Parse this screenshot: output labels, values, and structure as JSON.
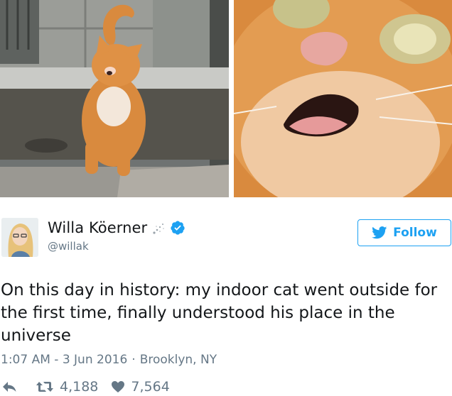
{
  "author": {
    "display_name": "Willa Köerner",
    "handle": "@willak",
    "verified": true
  },
  "follow_button": {
    "label": "Follow",
    "icon": "twitter-bird-icon"
  },
  "tweet": {
    "text": "On this day in history: my indoor cat went outside for the first time, finally understood his place in the universe",
    "time": "1:07 AM - 3 Jun 2016",
    "separator": "·",
    "location": "Brooklyn, NY"
  },
  "stats": {
    "retweets": "4,188",
    "likes": "7,564"
  },
  "icons": {
    "reply": "reply-icon",
    "retweet": "retweet-icon",
    "like": "heart-icon",
    "verified": "verified-badge-icon",
    "sparkle": "sparkle-icon"
  },
  "colors": {
    "accent": "#1da1f2",
    "text": "#14171a",
    "muted": "#657786"
  }
}
